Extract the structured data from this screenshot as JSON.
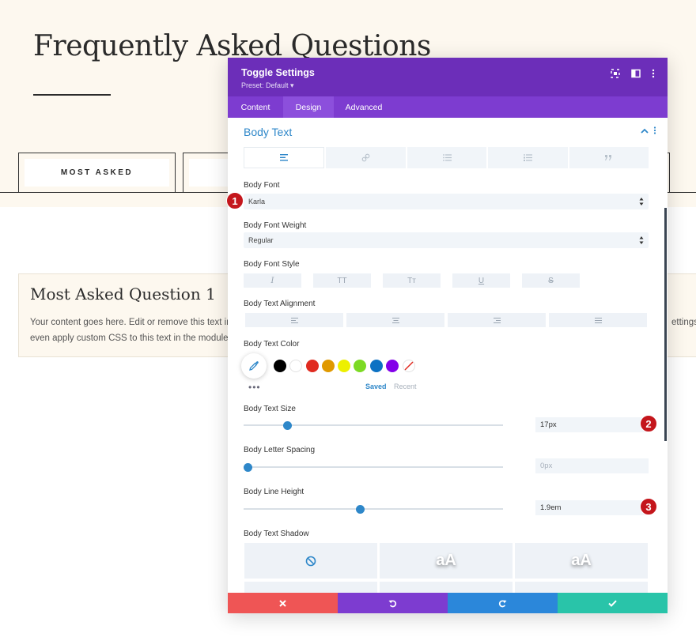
{
  "background": {
    "faq_title": "Frequently Asked Questions",
    "tab_most_asked": "MOST ASKED",
    "toggle_title": "Most Asked Question 1",
    "toggle_line1": "Your content goes here. Edit or remove this text in",
    "toggle_line2": "even apply custom CSS to this text in the module",
    "toggle_tail": "ettings"
  },
  "modal": {
    "title": "Toggle Settings",
    "preset": "Preset: Default ▾",
    "tabs": [
      {
        "label": "Content"
      },
      {
        "label": "Design"
      },
      {
        "label": "Advanced"
      }
    ],
    "section_title": "Body Text",
    "body_font_label": "Body Font",
    "body_font_value": "Karla",
    "body_font_weight_label": "Body Font Weight",
    "body_font_weight_value": "Regular",
    "body_font_style_label": "Body Font Style",
    "font_style_buttons": [
      "I",
      "TT",
      "Tт",
      "U",
      "S"
    ],
    "body_text_alignment_label": "Body Text Alignment",
    "body_text_color_label": "Body Text Color",
    "color_swatches": [
      "#000000",
      "#ffffff",
      "#e02b20",
      "#e09900",
      "#edf000",
      "#7cda24",
      "#0c71c3",
      "#8300e9"
    ],
    "saved_label": "Saved",
    "recent_label": "Recent",
    "more_dots": "•••",
    "body_text_size_label": "Body Text Size",
    "body_text_size_value": "17px",
    "body_text_size_fraction": 0.17,
    "body_letter_spacing_label": "Body Letter Spacing",
    "body_letter_spacing_value": "0px",
    "body_letter_spacing_fraction": 0.0,
    "body_line_height_label": "Body Line Height",
    "body_line_height_value": "1.9em",
    "body_line_height_fraction": 0.45,
    "body_text_shadow_label": "Body Text Shadow",
    "shadow_samples": [
      "aA",
      "aA"
    ]
  },
  "badges": [
    "1",
    "2",
    "3"
  ],
  "colors": {
    "header": "#6c2eb9",
    "tabs_bar": "#7d3cd0",
    "accent": "#2e87c9",
    "cancel": "#ef5555",
    "undo": "#7d3cd0",
    "redo": "#2b87da",
    "save": "#29c4a9",
    "badge": "#c4161c"
  }
}
